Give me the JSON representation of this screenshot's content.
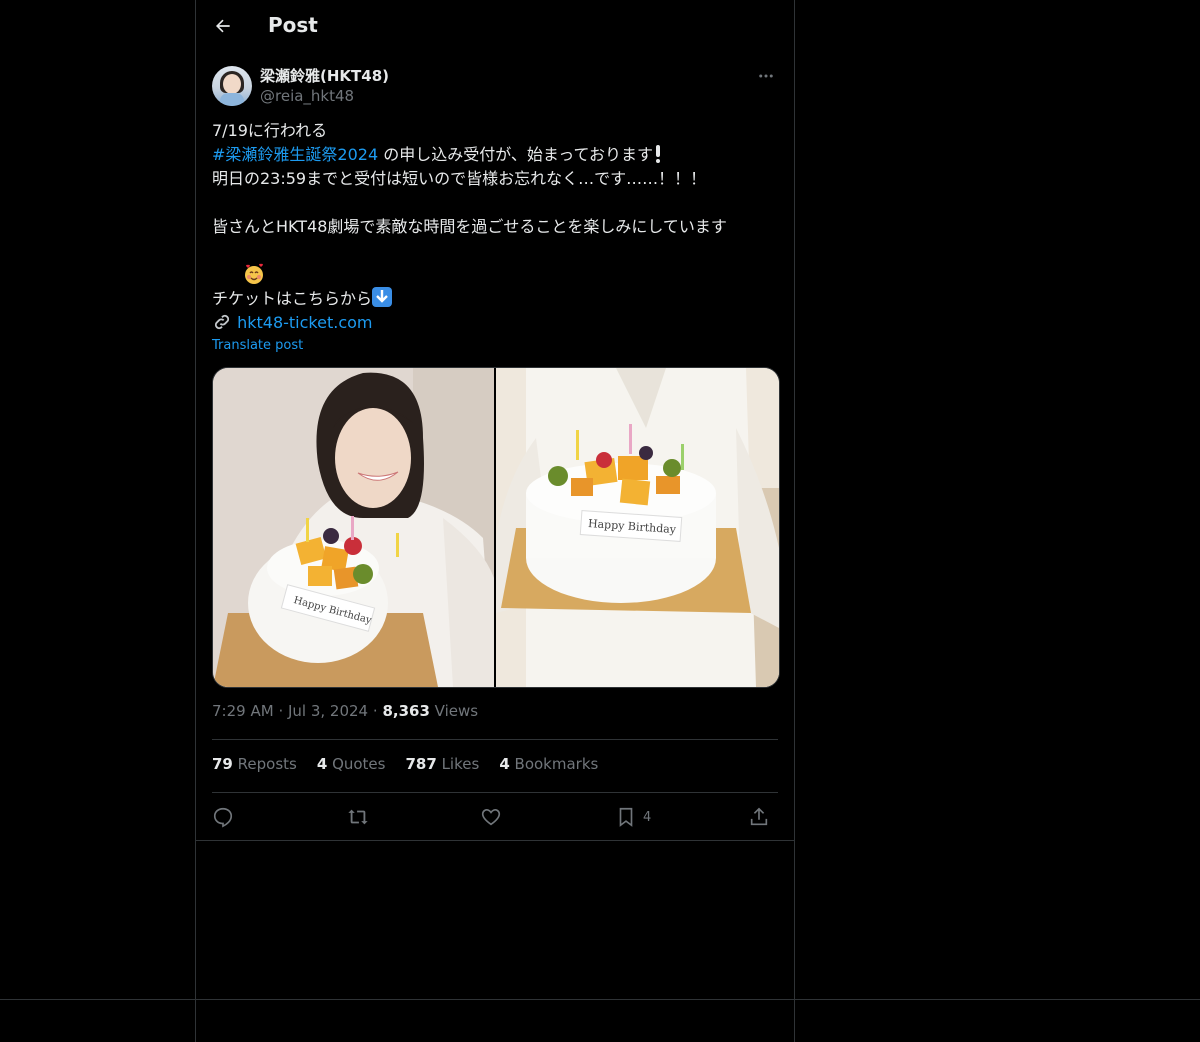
{
  "header": {
    "title": "Post"
  },
  "author": {
    "display_name": "梁瀬鈴雅(HKT48)",
    "handle": "@reia_hkt48"
  },
  "post": {
    "line1": "7/19に行われる",
    "hashtag": "#梁瀬鈴雅生誕祭2024",
    "line2_rest": " の申し込み受付が、始まっております",
    "line3": "明日の23:59までと受付は短いので皆様お忘れなく…です……！！！",
    "line4": "皆さんとHKT48劇場で素敵な時間を過ごせることを楽しみにしています",
    "line5": "チケットはこちらから",
    "link": "hkt48-ticket.com",
    "translate": "Translate post"
  },
  "media": {
    "photo1_alt": "Selfie holding a fruit-topped birthday cake",
    "photo2_alt": "Holding a Happy Birthday cake on a gold board",
    "cake_label": "Happy Birthday"
  },
  "meta": {
    "time": "7:29 AM",
    "date": "Jul 3, 2024",
    "views_count": "8,363",
    "views_label": "Views"
  },
  "stats": {
    "reposts": {
      "count": "79",
      "label": "Reposts"
    },
    "quotes": {
      "count": "4",
      "label": "Quotes"
    },
    "likes": {
      "count": "787",
      "label": "Likes"
    },
    "bookmarks": {
      "count": "4",
      "label": "Bookmarks"
    }
  },
  "actions": {
    "bookmark_count": "4"
  },
  "colors": {
    "background": "#000000",
    "text": "#e7e9ea",
    "muted": "#71767b",
    "accent": "#1d9bf0",
    "border": "#2f3336"
  },
  "icons": [
    "back-arrow-icon",
    "more-icon",
    "link-emoji-icon",
    "reply-icon",
    "repost-icon",
    "like-icon",
    "bookmark-icon",
    "share-icon"
  ]
}
